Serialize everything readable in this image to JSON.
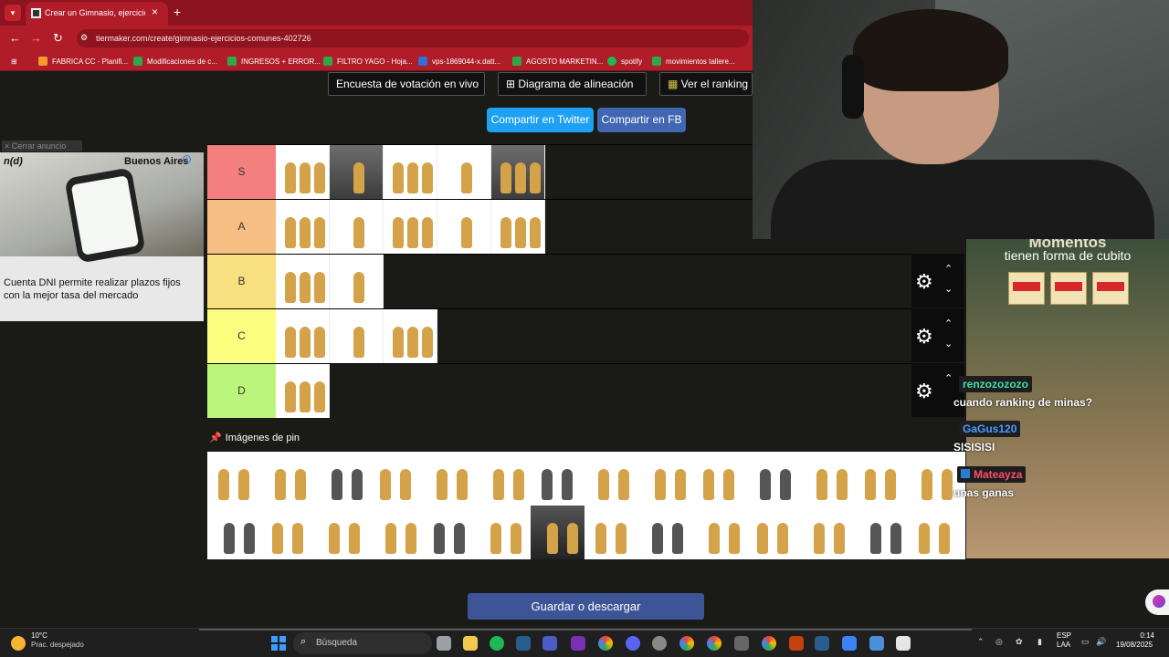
{
  "browser": {
    "tab_title": "Crear un Gimnasio, ejercicios c",
    "url": "tiermaker.com/create/gimnasio-ejercicios-comunes-402726",
    "bookmarks": [
      "FABRICA CC - Planifi...",
      "Modificaciones de c...",
      "INGRESOS + ERROR...",
      "FILTRO YAGO - Hoja...",
      "vps-1869044-x.datt...",
      "AGOSTO MARKETIN...",
      "spotify",
      "movimientos tallere..."
    ]
  },
  "toolbar": {
    "poll_label": "Encuesta de votación en vivo",
    "alignment_label": "Diagrama de alineación",
    "ranking_label": "Ver el ranking",
    "share_twitter": "Compartir en Twitter",
    "share_fb": "Compartir en FB"
  },
  "ad": {
    "close_label": "Cerrar anuncio",
    "brand": "n(d)",
    "location": "Buenos Aires",
    "headline": "Cuenta DNI permite realizar plazos fijos con la mejor tasa del mercado"
  },
  "tiers": [
    {
      "label": "S",
      "color": "#f47f7f",
      "count": 5
    },
    {
      "label": "A",
      "color": "#f7be84",
      "count": 5
    },
    {
      "label": "B",
      "color": "#f8df80",
      "count": 2
    },
    {
      "label": "C",
      "color": "#fbfd7e",
      "count": 3
    },
    {
      "label": "D",
      "color": "#bcf57c",
      "count": 1
    }
  ],
  "pin": {
    "title": "Imágenes de pin",
    "count": 28
  },
  "save_label": "Guardar o descargar",
  "promo": {
    "title": "Momentos",
    "subtitle": "tienen forma de cubito"
  },
  "chat": [
    {
      "user": "renzozozozo",
      "message": "cuando ranking de minas?",
      "color": "#3de0b0"
    },
    {
      "user": "GaGus120",
      "message": "SISISISI",
      "color": "#4b9bff"
    },
    {
      "user": "Mateayza",
      "message": "unas ganas",
      "color": "#ff4f6d"
    }
  ],
  "taskbar": {
    "temperature": "10°C",
    "weather": "Prac. despejado",
    "search_placeholder": "Búsqueda",
    "lang": "ESP",
    "lang_sub": "LAA",
    "time": "0:14",
    "date": "19/08/2025"
  }
}
